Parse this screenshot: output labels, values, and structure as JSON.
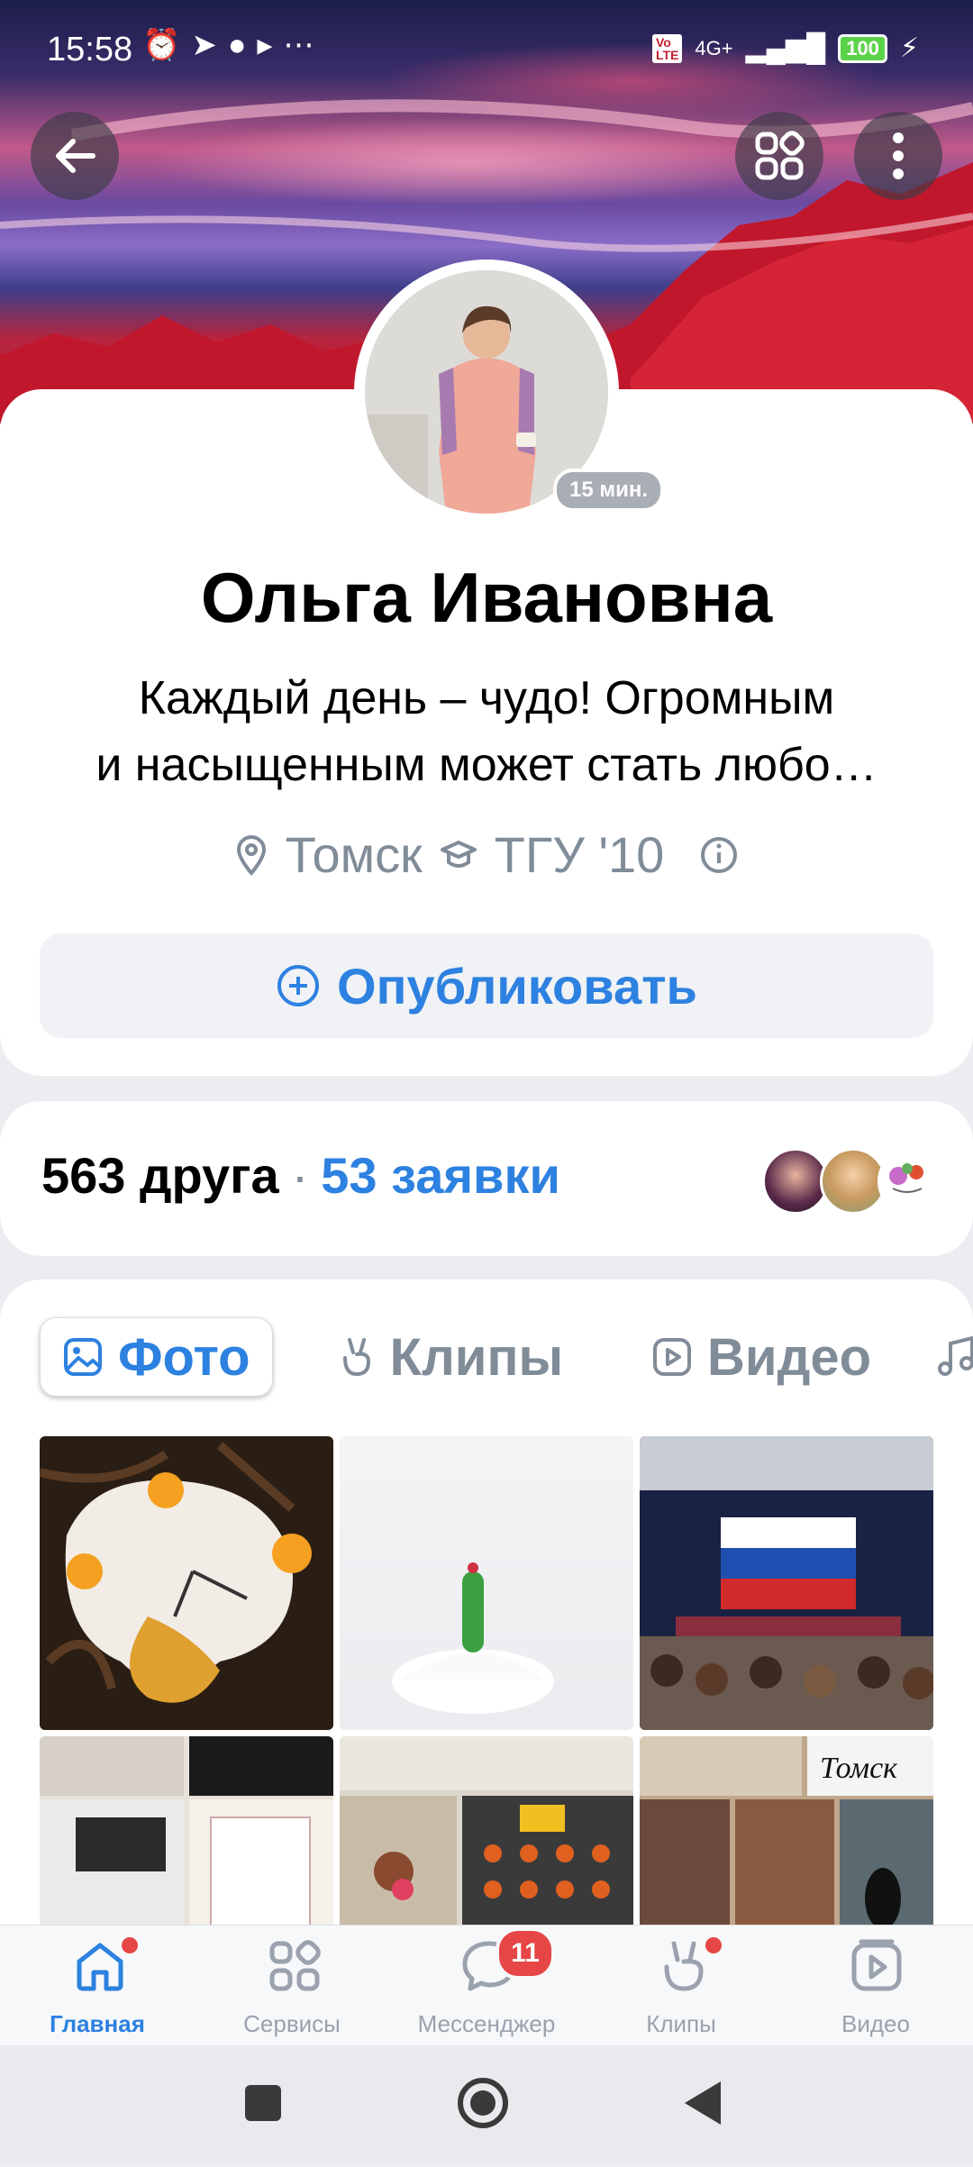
{
  "status_bar": {
    "time": "15:58",
    "network": "4G+",
    "battery": "100"
  },
  "profile": {
    "name": "Ольга Ивановна",
    "online_badge": "15 мин.",
    "status_line1": "Каждый день – чудо! Огромным",
    "status_line2": "и насыщенным может стать любо…",
    "city": "Томск",
    "university": "ТГУ '10",
    "publish_label": "Опубликовать"
  },
  "friends": {
    "count_label": "563 друга",
    "separator": "·",
    "requests_label": "53 заявки"
  },
  "media_tabs": [
    {
      "label": "Фото",
      "icon": "photo-icon",
      "active": true
    },
    {
      "label": "Клипы",
      "icon": "clips-icon",
      "active": false
    },
    {
      "label": "Видео",
      "icon": "video-icon",
      "active": false
    }
  ],
  "bottom_nav": [
    {
      "label": "Главная",
      "icon": "home-icon",
      "active": true,
      "dot": true
    },
    {
      "label": "Сервисы",
      "icon": "services-icon",
      "active": false
    },
    {
      "label": "Мессенджер",
      "icon": "messenger-icon",
      "active": false,
      "badge": "11"
    },
    {
      "label": "Клипы",
      "icon": "clips-icon",
      "active": false,
      "dot": true
    },
    {
      "label": "Видео",
      "icon": "video-icon",
      "active": false
    }
  ],
  "colors": {
    "accent": "#2d81e0",
    "secondary_text": "#818c99",
    "badge_red": "#e64646",
    "page_bg": "#ebedf0"
  }
}
